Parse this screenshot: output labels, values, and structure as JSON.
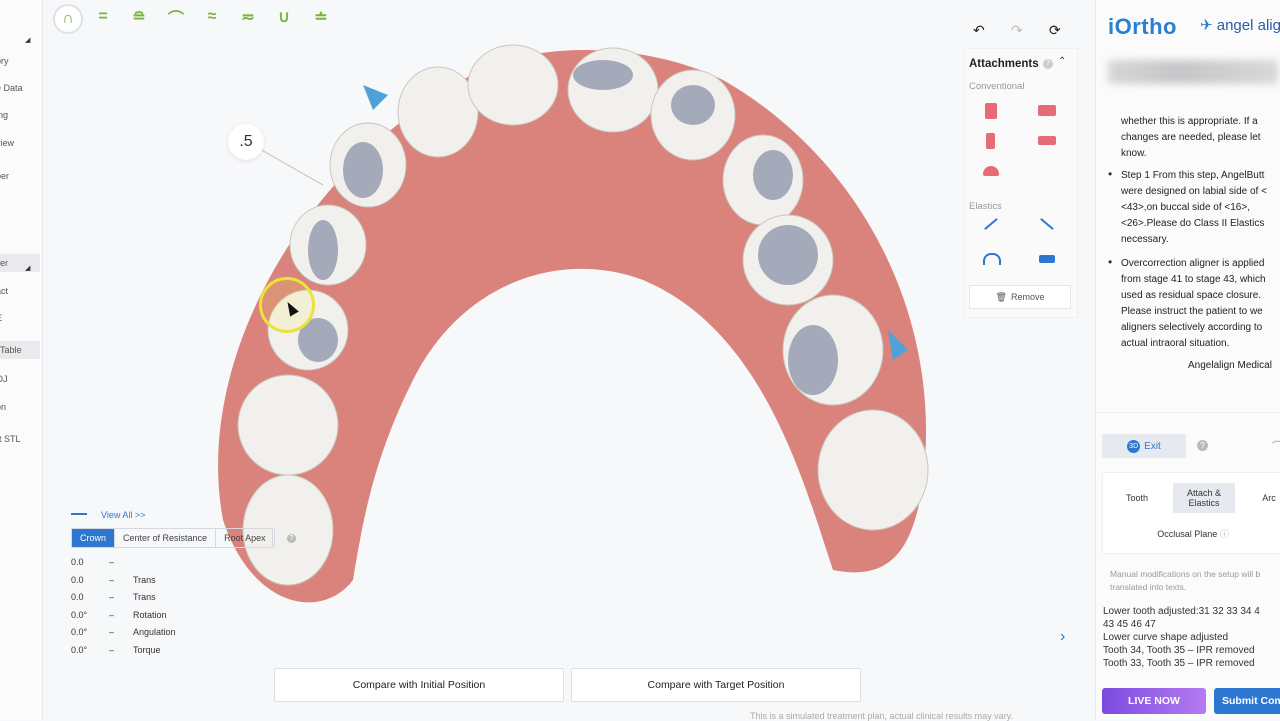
{
  "left_sidebar": {
    "items": [
      "ory",
      "e Data",
      "ing",
      "view",
      "ber",
      "",
      "er",
      "act",
      "E",
      "Table",
      "OJ",
      "on",
      "rt STL"
    ]
  },
  "toolbar": {
    "icons": [
      "arch-full-icon",
      "align-icon",
      "curve-icon",
      "arch-upper-icon",
      "spread-icon",
      "compress-icon",
      "arch-lower-icon",
      "bite-icon"
    ]
  },
  "viewport": {
    "tooth_label": ".5",
    "view_all": "View All >>",
    "tabs": [
      "Crown",
      "Center of Resistance",
      "Root Apex"
    ],
    "movement_rows": [
      {
        "value": "0.0",
        "label": ""
      },
      {
        "value": "0.0",
        "label": "Trans"
      },
      {
        "value": "0.0",
        "label": "Trans"
      },
      {
        "value": "0.0°",
        "label": "Rotation"
      },
      {
        "value": "0.0°",
        "label": "Angulation"
      },
      {
        "value": "0.0°",
        "label": "Torque"
      }
    ],
    "dash": "–",
    "compare_initial": "Compare with Initial Position",
    "compare_target": "Compare with Target Position",
    "disclaimer": "This is a simulated treatment plan, actual clinical results may vary."
  },
  "attachments": {
    "title": "Attachments",
    "conventional": "Conventional",
    "elastics": "Elastics",
    "remove": "Remove"
  },
  "right_panel": {
    "logo_iortho": "iOrtho",
    "logo_angel": "angel alig",
    "note_lines_1": [
      "whether this is appropriate. If a",
      "changes are needed, please let",
      "know."
    ],
    "note_bullet_2": [
      "Step 1 From this step, AngelButt",
      "were designed on labial side of <",
      "<43>,on buccal side of <16>,",
      "<26>.Please do Class II Elastics",
      "necessary."
    ],
    "note_bullet_3": [
      "Overcorrection aligner is applied",
      "from stage 41 to stage 43, which",
      "used as residual space closure.",
      "Please instruct the patient to we",
      "aligners selectively according to",
      "actual intraoral situation."
    ],
    "signature": "Angelalign Medical",
    "exit": "Exit",
    "tabs": [
      "Tooth",
      "Attach & Elastics",
      "Arc"
    ],
    "occlusal_plane": "Occlusal Plane",
    "manual_note": "Manual modifications on the setup will b translated into texts.",
    "adjust_log": [
      "Lower tooth adjusted:31 32 33 34 4",
      "43 45 46 47",
      "Lower curve shape adjusted",
      "Tooth 34, Tooth 35 – IPR removed",
      "Tooth 33, Tooth 35 – IPR removed"
    ],
    "live_now": "LIVE NOW",
    "submit": "Submit Com"
  }
}
